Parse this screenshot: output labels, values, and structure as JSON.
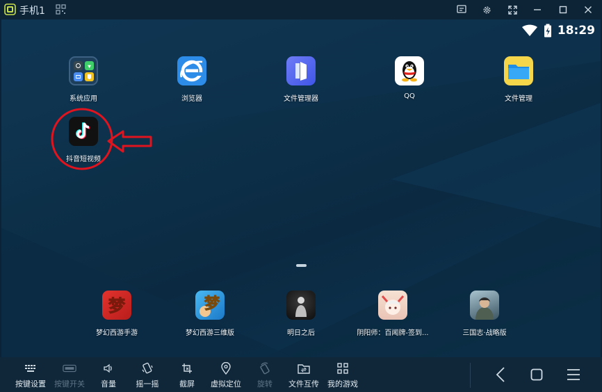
{
  "window": {
    "title": "手机1"
  },
  "status": {
    "time": "18:29"
  },
  "home_apps": [
    {
      "label": "系统应用",
      "icon": "system-apps-folder-icon"
    },
    {
      "label": "浏览器",
      "icon": "browser-icon"
    },
    {
      "label": "文件管理器",
      "icon": "file-manager-icon"
    },
    {
      "label": "QQ",
      "icon": "qq-penguin-icon"
    },
    {
      "label": "文件管理",
      "icon": "folder-icon"
    },
    {
      "label": "抖音短视频",
      "icon": "douyin-icon"
    }
  ],
  "dock_apps": [
    {
      "label": "梦幻西游手游",
      "icon": "menghuan-xiyou-icon"
    },
    {
      "label": "梦幻西游三维版",
      "icon": "menghuan-xiyou-3d-icon"
    },
    {
      "label": "明日之后",
      "icon": "mingri-zhihou-icon"
    },
    {
      "label": "阴阳师：百闻牌-签到...",
      "icon": "onmyoji-card-icon"
    },
    {
      "label": "三国志·战略版",
      "icon": "sanguozhi-icon"
    }
  ],
  "bottom_toolbar": [
    {
      "label": "按键设置",
      "icon": "keyboard-icon",
      "enabled": true
    },
    {
      "label": "按键开关",
      "icon": "key-toggle-icon",
      "enabled": false
    },
    {
      "label": "音量",
      "icon": "volume-icon",
      "enabled": true
    },
    {
      "label": "摇一摇",
      "icon": "shake-icon",
      "enabled": true
    },
    {
      "label": "截屏",
      "icon": "screenshot-crop-icon",
      "enabled": true
    },
    {
      "label": "虚拟定位",
      "icon": "location-pin-icon",
      "enabled": true
    },
    {
      "label": "旋转",
      "icon": "rotate-icon",
      "enabled": false
    },
    {
      "label": "文件互传",
      "icon": "file-transfer-icon",
      "enabled": true
    },
    {
      "label": "我的游戏",
      "icon": "my-games-grid-icon",
      "enabled": true
    }
  ],
  "colors": {
    "accent_red": "#e0141e",
    "background": "#0c2236",
    "toolbar": "#10273a"
  }
}
